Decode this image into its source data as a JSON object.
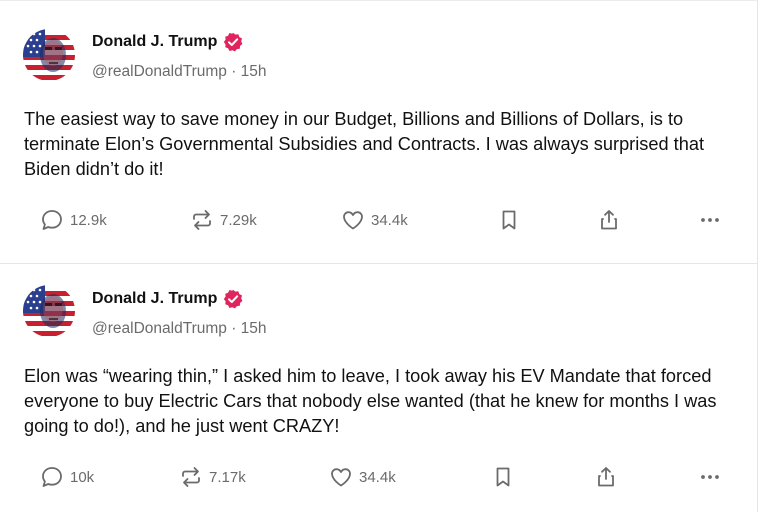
{
  "colors": {
    "verified": "#e0245e",
    "text": "#111111",
    "muted": "#6b6b6b",
    "divider": "#e6e6e6"
  },
  "posts": [
    {
      "author": {
        "name": "Donald J. Trump",
        "handle": "@realDonaldTrump",
        "time": "· 15h",
        "avatar_icon": "avatar-image",
        "verified_icon": "verified-badge-icon"
      },
      "text": "The easiest way to save money in our Budget, Billions and Billions of Dollars, is to terminate Elon’s Governmental Subsidies and Contracts. I was always surprised that Biden didn’t do it!",
      "stats": {
        "replies": "12.9k",
        "reposts": "7.29k",
        "likes": "34.4k"
      }
    },
    {
      "author": {
        "name": "Donald J. Trump",
        "handle": "@realDonaldTrump",
        "time": "· 15h",
        "avatar_icon": "avatar-image",
        "verified_icon": "verified-badge-icon"
      },
      "text": "Elon was “wearing thin,” I asked him to leave, I took away his EV Mandate that forced everyone to buy Electric Cars that nobody else wanted (that he knew for months I was going to do!), and he just went CRAZY!",
      "stats": {
        "replies": "10k",
        "reposts": "7.17k",
        "likes": "34.4k"
      }
    }
  ],
  "action_icons": [
    "reply-icon",
    "repost-icon",
    "like-icon",
    "bookmark-icon",
    "share-icon",
    "more-icon"
  ]
}
